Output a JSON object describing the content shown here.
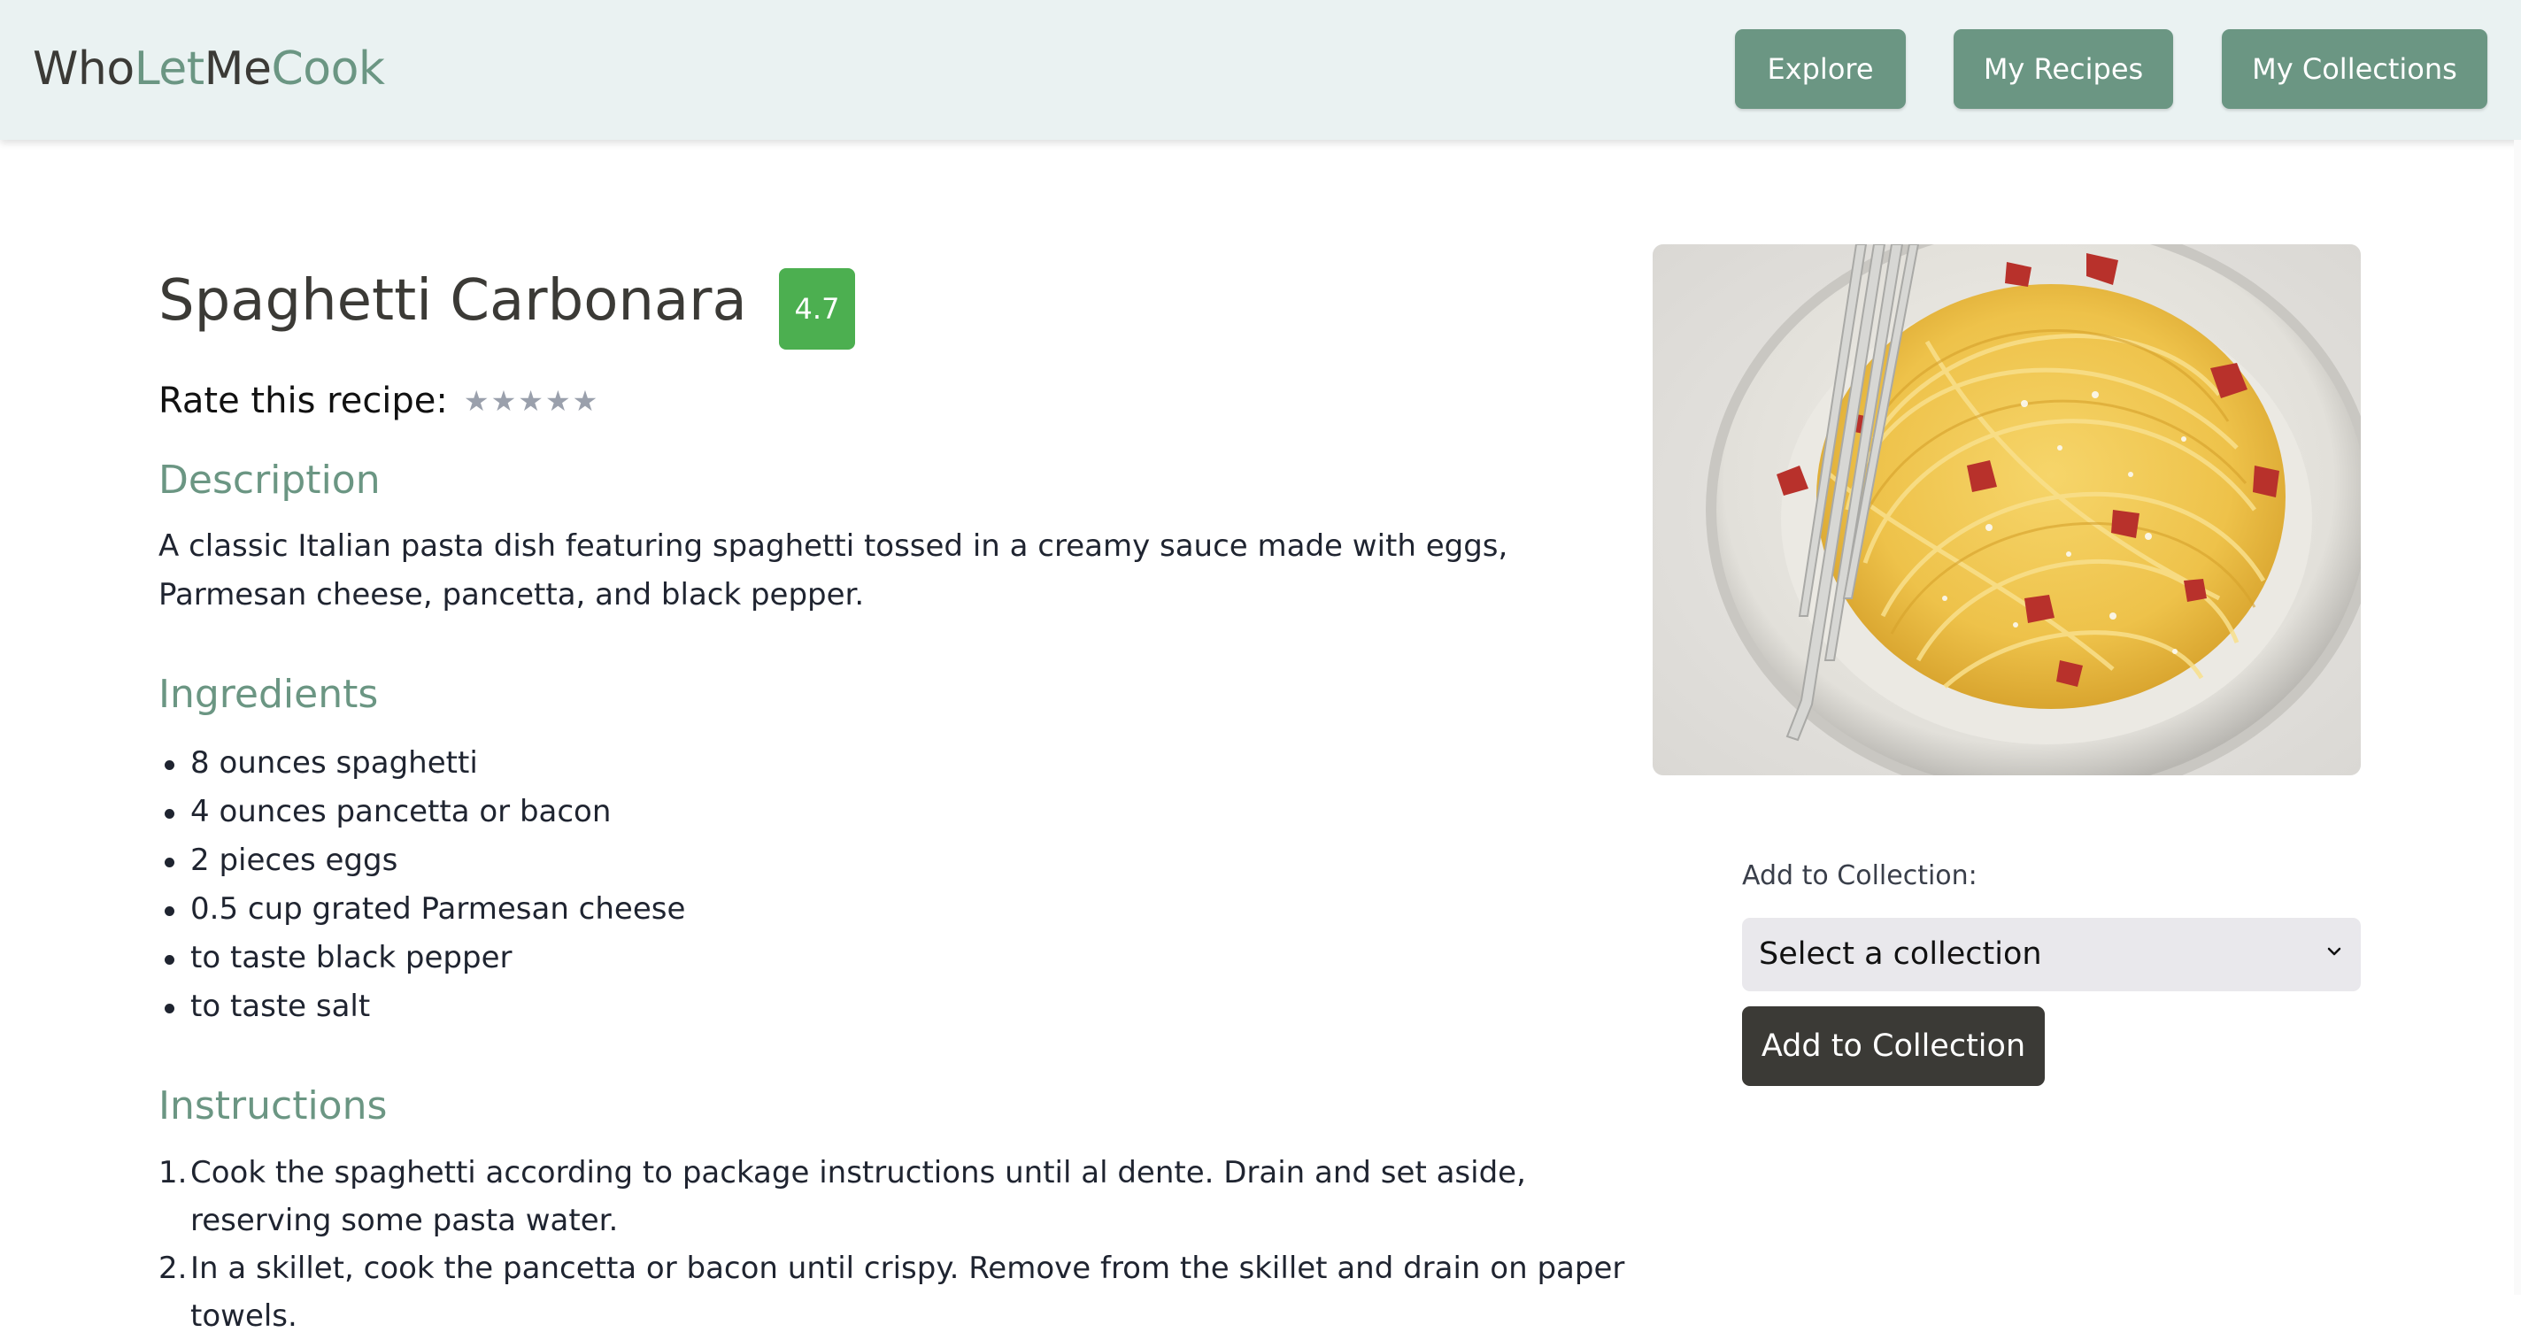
{
  "brand": {
    "part1": "Who",
    "part2": "Let",
    "part3": "Me",
    "part4": "Cook"
  },
  "nav": {
    "explore": "Explore",
    "my_recipes": "My Recipes",
    "my_collections": "My Collections"
  },
  "recipe": {
    "title": "Spaghetti Carbonara",
    "rating": "4.7",
    "rate_label": "Rate this recipe:",
    "stars": [
      "★",
      "★",
      "★",
      "★",
      "★"
    ],
    "user_rating": 0,
    "description_heading": "Description",
    "description": "A classic Italian pasta dish featuring spaghetti tossed in a creamy sauce made with eggs, Parmesan cheese, pancetta, and black pepper.",
    "ingredients_heading": "Ingredients",
    "ingredients": [
      "8 ounces spaghetti",
      "4 ounces pancetta or bacon",
      "2 pieces eggs",
      "0.5 cup grated Parmesan cheese",
      "to taste black pepper",
      "to taste salt"
    ],
    "instructions_heading": "Instructions",
    "instructions": [
      {
        "num": "1.",
        "text": "Cook the spaghetti according to package instructions until al dente. Drain and set aside, reserving some pasta water."
      },
      {
        "num": "2.",
        "text": "In a skillet, cook the pancetta or bacon until crispy. Remove from the skillet and drain on paper towels."
      }
    ]
  },
  "collection": {
    "label": "Add to Collection:",
    "select_value": "Select a collection",
    "button_label": "Add to Collection"
  },
  "colors": {
    "accent": "#6b9683",
    "header_bg": "#eaf2f2",
    "rating_badge": "#4caf50",
    "dark_button": "#3b3a36"
  },
  "icons": {
    "chevron": "chevron-down-icon",
    "star": "star-icon"
  }
}
